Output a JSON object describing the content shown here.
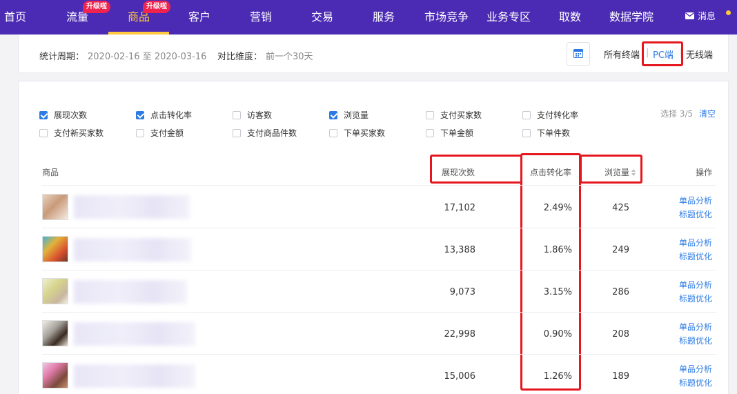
{
  "nav": {
    "items": [
      {
        "label": "首页",
        "badge": ""
      },
      {
        "label": "流量",
        "badge": "升级啦"
      },
      {
        "label": "商品",
        "badge": "升级啦",
        "active": true
      },
      {
        "label": "客户",
        "badge": ""
      },
      {
        "label": "营销",
        "badge": ""
      },
      {
        "label": "交易",
        "badge": ""
      },
      {
        "label": "服务",
        "badge": ""
      },
      {
        "label": "市场竞争",
        "badge": ""
      },
      {
        "label": "业务专区",
        "badge": ""
      },
      {
        "label": "取数",
        "badge": ""
      },
      {
        "label": "数据学院",
        "badge": ""
      }
    ],
    "message_label": "消息",
    "accent": "#ffc93d",
    "bg": "#4b2bb4"
  },
  "filters": {
    "period_label": "统计周期：",
    "period_value": "2020-02-16 至 2020-03-16",
    "compare_label": "对比维度：",
    "compare_value": "前一个30天",
    "calendar_icon": "calendar-icon",
    "terminals": {
      "all": "所有终端",
      "pc": "PC端",
      "wireless": "无线端",
      "separator": "|"
    }
  },
  "metrics": {
    "options": [
      {
        "label": "展现次数",
        "checked": true
      },
      {
        "label": "点击转化率",
        "checked": true
      },
      {
        "label": "访客数",
        "checked": false
      },
      {
        "label": "浏览量",
        "checked": true
      },
      {
        "label": "支付买家数",
        "checked": false
      },
      {
        "label": "支付转化率",
        "checked": false
      },
      {
        "label": "支付新买家数",
        "checked": false
      },
      {
        "label": "支付金额",
        "checked": false
      },
      {
        "label": "支付商品件数",
        "checked": false
      },
      {
        "label": "下单买家数",
        "checked": false
      },
      {
        "label": "下单金额",
        "checked": false
      },
      {
        "label": "下单件数",
        "checked": false
      }
    ],
    "select_count": "选择 3/5",
    "clear_label": "清空"
  },
  "table": {
    "headers": {
      "product": "商品",
      "impressions": "展现次数",
      "ctr": "点击转化率",
      "views": "浏览量",
      "ops": "操作"
    },
    "rows": [
      {
        "impressions": "17,102",
        "ctr": "2.49%",
        "views": "425",
        "action1": "单品分析",
        "action2": "标题优化"
      },
      {
        "impressions": "13,388",
        "ctr": "1.86%",
        "views": "249",
        "action1": "单品分析",
        "action2": "标题优化"
      },
      {
        "impressions": "9,073",
        "ctr": "3.15%",
        "views": "286",
        "action1": "单品分析",
        "action2": "标题优化"
      },
      {
        "impressions": "22,998",
        "ctr": "0.90%",
        "views": "208",
        "action1": "单品分析",
        "action2": "标题优化"
      },
      {
        "impressions": "15,006",
        "ctr": "1.26%",
        "views": "189",
        "action1": "单品分析",
        "action2": "标题优化"
      }
    ]
  },
  "colors": {
    "link": "#2c7be5",
    "highlight": "#e5161e"
  }
}
